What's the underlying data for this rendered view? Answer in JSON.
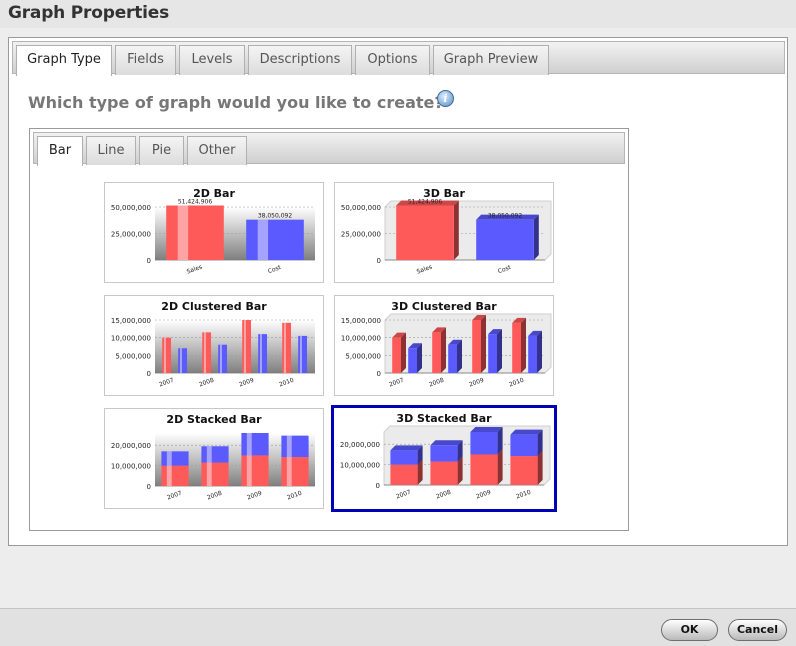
{
  "window": {
    "title": "Graph Properties"
  },
  "tabs": [
    "Graph Type",
    "Fields",
    "Levels",
    "Descriptions",
    "Options",
    "Graph Preview"
  ],
  "active_tab": "Graph Type",
  "question": "Which type of graph would you like to create?",
  "info_icon": "info-icon",
  "subtabs": [
    "Bar",
    "Line",
    "Pie",
    "Other"
  ],
  "active_subtab": "Bar",
  "colors": {
    "series_a": "#ff5a5a",
    "series_b": "#5a5aff",
    "selection": "#0000b8"
  },
  "thumbnails": [
    {
      "title": "2D Bar",
      "chart_data": {
        "type": "bar",
        "categories": [
          "Sales",
          "Cost"
        ],
        "values": [
          51424906,
          38050092
        ],
        "data_labels": [
          "51,424,906",
          "38,050,092"
        ],
        "ylim": [
          0,
          50000000
        ],
        "yticks": [
          "50,000,000",
          "25,000,000",
          "0"
        ],
        "grid": true
      }
    },
    {
      "title": "3D Bar",
      "chart_data": {
        "type": "bar",
        "categories": [
          "Sales",
          "Cost"
        ],
        "values": [
          51424906,
          38050092
        ],
        "data_labels": [
          "51,424,906",
          "38,050,092"
        ],
        "ylim": [
          0,
          50000000
        ],
        "yticks": [
          "50,000,000",
          "25,000,000",
          "0"
        ],
        "grid": true
      }
    },
    {
      "title": "2D Clustered Bar",
      "chart_data": {
        "type": "bar",
        "categories": [
          "2007",
          "2008",
          "2009",
          "2010"
        ],
        "series": [
          {
            "values": [
              10000000,
              11500000,
              15000000,
              14200000
            ]
          },
          {
            "values": [
              7000000,
              8000000,
              11000000,
              10500000
            ]
          }
        ],
        "ylim": [
          0,
          15000000
        ],
        "yticks": [
          "15,000,000",
          "10,000,000",
          "5,000,000",
          "0"
        ],
        "grid": true
      }
    },
    {
      "title": "3D Clustered Bar",
      "chart_data": {
        "type": "bar",
        "categories": [
          "2007",
          "2008",
          "2009",
          "2010"
        ],
        "series": [
          {
            "values": [
              10000000,
              11500000,
              15000000,
              14200000
            ]
          },
          {
            "values": [
              7000000,
              8000000,
              11000000,
              10500000
            ]
          }
        ],
        "ylim": [
          0,
          15000000
        ],
        "yticks": [
          "15,000,000",
          "10,000,000",
          "5,000,000",
          "0"
        ],
        "grid": true
      }
    },
    {
      "title": "2D Stacked Bar",
      "chart_data": {
        "type": "bar",
        "stacked": true,
        "categories": [
          "2007",
          "2008",
          "2009",
          "2010"
        ],
        "series": [
          {
            "values": [
              10000000,
              11500000,
              15000000,
              14200000
            ]
          },
          {
            "values": [
              7000000,
              8000000,
              11000000,
              10500000
            ]
          }
        ],
        "ylim": [
          0,
          26000000
        ],
        "yticks": [
          "20,000,000",
          "10,000,000",
          "0"
        ],
        "grid": true
      }
    },
    {
      "title": "3D Stacked Bar",
      "chart_data": {
        "type": "bar",
        "stacked": true,
        "categories": [
          "2007",
          "2008",
          "2009",
          "2010"
        ],
        "series": [
          {
            "values": [
              10000000,
              11500000,
              15000000,
              14200000
            ]
          },
          {
            "values": [
              7000000,
              8000000,
              11000000,
              10500000
            ]
          }
        ],
        "ylim": [
          0,
          26000000
        ],
        "yticks": [
          "20,000,000",
          "10,000,000",
          "0"
        ],
        "grid": true
      }
    }
  ],
  "selected_thumbnail": "3D Stacked Bar",
  "buttons": {
    "ok": "OK",
    "cancel": "Cancel"
  }
}
